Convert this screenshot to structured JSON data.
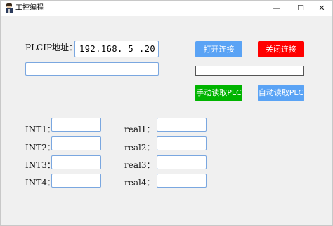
{
  "window": {
    "title": "工控编程",
    "minimize_glyph": "—",
    "maximize_glyph": "☐",
    "close_glyph": "✕"
  },
  "connection": {
    "plc_ip_label": "PLCIP地址：",
    "plc_ip_value": "192.168. 5 .20",
    "status_value": "",
    "connect_label": "打开连接",
    "disconnect_label": "关闭连接",
    "progress": 0
  },
  "reading": {
    "manual_label": "手动读取PLC",
    "auto_label": "自动读取PLC"
  },
  "int_fields": [
    {
      "label": "INT1：",
      "value": ""
    },
    {
      "label": "INT2：",
      "value": ""
    },
    {
      "label": "INT3：",
      "value": ""
    },
    {
      "label": "INT4：",
      "value": ""
    }
  ],
  "real_fields": [
    {
      "label": "real1：",
      "value": ""
    },
    {
      "label": "real2：",
      "value": ""
    },
    {
      "label": "real3：",
      "value": ""
    },
    {
      "label": "real4：",
      "value": ""
    }
  ],
  "colors": {
    "connect_button": "#5aa3f5",
    "disconnect_button": "#ff0000",
    "manual_read_button": "#00b400",
    "auto_read_button": "#5aa3f5",
    "textbox_border": "#7aa7e0"
  }
}
